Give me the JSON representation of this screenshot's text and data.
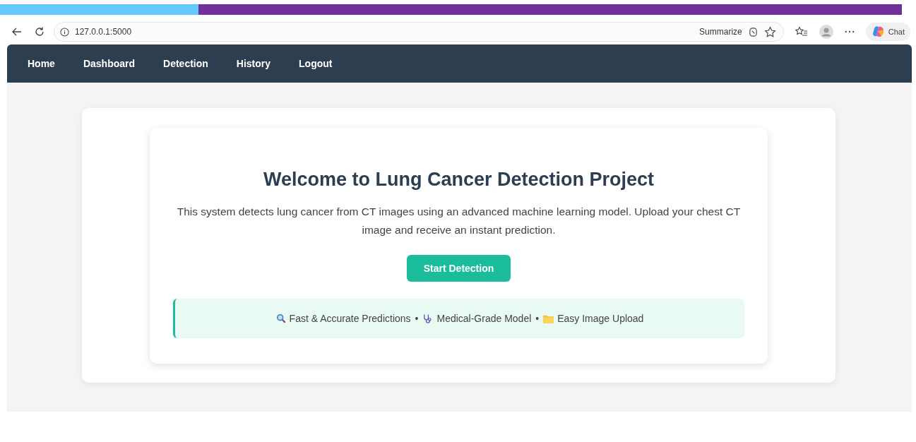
{
  "loading_bar": {
    "level": 0.22
  },
  "browser": {
    "url": "127.0.0.1:5000",
    "summarize": "Summarize",
    "chat": "Chat"
  },
  "nav": [
    {
      "label": "Home"
    },
    {
      "label": "Dashboard"
    },
    {
      "label": "Detection"
    },
    {
      "label": "History"
    },
    {
      "label": "Logout"
    }
  ],
  "hero": {
    "title": "Welcome to Lung Cancer Detection Project",
    "description": "This system detects lung cancer from CT images using an advanced machine learning model. Upload your chest CT image and receive an instant prediction.",
    "button": "Start Detection"
  },
  "features": [
    {
      "kind": "search",
      "text": "Fast & Accurate Predictions"
    },
    {
      "kind": "separator",
      "text": "•"
    },
    {
      "kind": "stethoscope",
      "text": "Medical-Grade Model"
    },
    {
      "kind": "separator",
      "text": "•"
    },
    {
      "kind": "folder",
      "text": "Easy Image Upload"
    }
  ]
}
